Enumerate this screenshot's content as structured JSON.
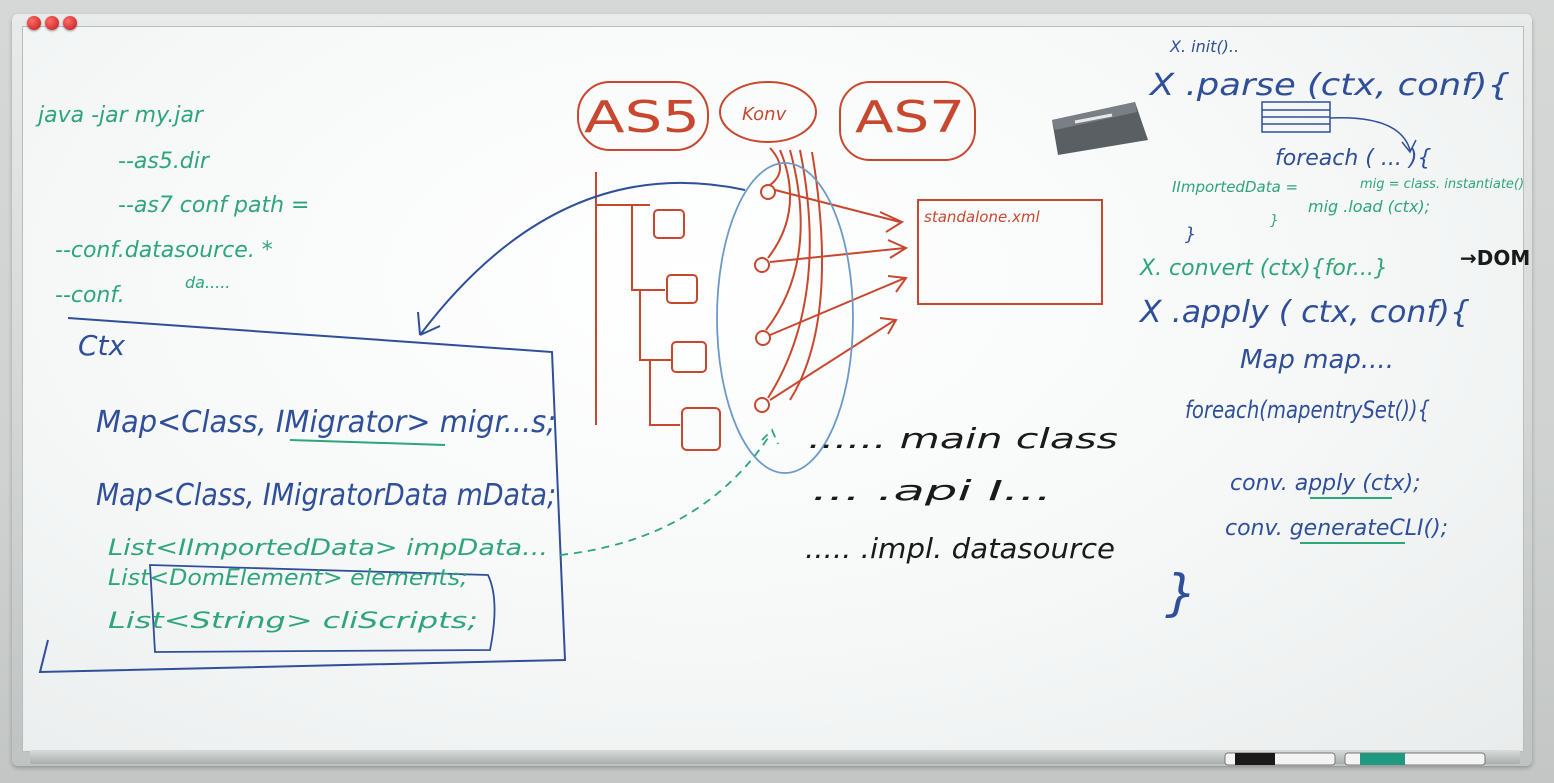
{
  "board": {
    "left": {
      "cmd": "java -jar my.jar",
      "opt1": "--as5.dir",
      "opt2": "--as7 conf path =",
      "opt3": "--conf.datasource. *",
      "opt4a": "da.....",
      "opt4b": "--conf.",
      "ctx_title": "Ctx",
      "map1": "Map<Class, IMigrator> migr...s;",
      "map2": "Map<Class, IMigratorData mData;",
      "list1": "List<IImportedData> impData...",
      "list2": "List<DomElement> elements;",
      "list3": "List<String> cliScripts;"
    },
    "center": {
      "as5": "AS5",
      "konv": "Konv",
      "as7": "AS7",
      "standalone": "standalone.xml",
      "pkg1": "...... main class",
      "pkg2": "... .api I...",
      "pkg3": "..... .impl. datasource"
    },
    "right": {
      "init": "X. init()..",
      "parse": "X .parse (ctx, conf){",
      "foreach1": "foreach ( ... ){",
      "iimported": "IImportedData =",
      "mig1": "mig = class. instantiate()",
      "mig2": "mig .load (ctx);",
      "close1": "}",
      "close2": "}",
      "convert": "X. convert (ctx){for...}",
      "dom": "→DOM",
      "apply": "X .apply ( ctx, conf){",
      "map": "Map map....",
      "foreach2": "foreach(mapentrySet()){",
      "conv_apply": "conv. apply (ctx);",
      "conv_gen": "conv. generateCLI();",
      "close3": "}"
    }
  },
  "colors": {
    "green": "#2fa57a",
    "blue": "#2f4f9a",
    "red": "#c8482f",
    "black": "#1a1a1a",
    "lightblue": "#6b9ac9"
  },
  "icons": {
    "magnets": "red-magnet-icon",
    "eraser": "eraser-icon",
    "markers": "marker-icon"
  }
}
